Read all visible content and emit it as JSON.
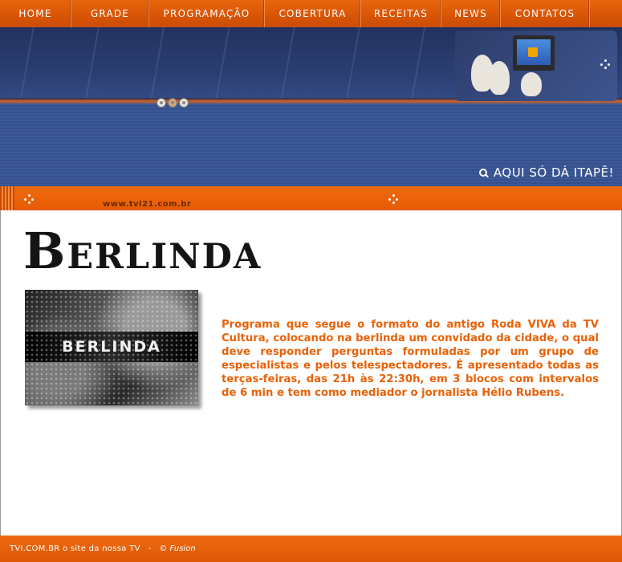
{
  "nav": {
    "items": [
      {
        "label": "HOME"
      },
      {
        "label": "GRADE"
      },
      {
        "label": "PROGRAMAÇÃO"
      },
      {
        "label": "COBERTURA"
      },
      {
        "label": "RECEITAS"
      },
      {
        "label": "NEWS"
      },
      {
        "label": "CONTATOS"
      }
    ]
  },
  "banner": {
    "slogan": "AQUI SÓ DÁ ITAPÊ!",
    "url": "www.tvi21.com.br",
    "icons": [
      "film-reel-icon",
      "tv-kids-photo",
      "magnifier-icon",
      "dots-icon"
    ]
  },
  "main": {
    "title": "Berlinda",
    "image_title": "BERLINDA",
    "description": "Programa que segue o formato do antigo Roda VIVA da TV Cultura, colocando na berlinda um convidado da cidade, o qual deve responder perguntas formuladas por um grupo de especialistas e pelos telespectadores. É apresentado todas as terças-feiras, das 21h às 22:30h, em 3 blocos com intervalos de 6 min e tem como mediador o jornalista Hélio Rubens."
  },
  "footer": {
    "site": "TVI.COM.BR  o site da nossa TV",
    "separator": "-",
    "credit": "© Fusion"
  },
  "colors": {
    "accent_orange": "#ea6106",
    "banner_blue": "#3b5897",
    "title_black": "#141414"
  }
}
